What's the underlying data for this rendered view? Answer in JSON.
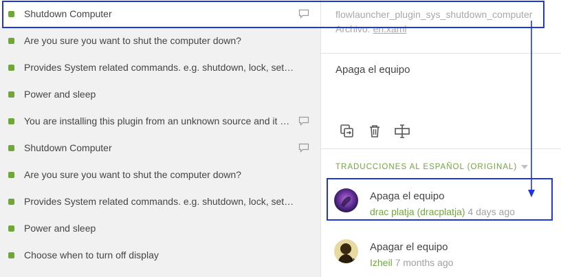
{
  "strings": [
    {
      "text": "Shutdown Computer",
      "has_comment": true,
      "selected": true
    },
    {
      "text": "Are you sure you want to shut the computer down?",
      "has_comment": false
    },
    {
      "text": "Provides System related commands. e.g. shutdown, lock, settings...",
      "has_comment": false
    },
    {
      "text": "Power and sleep",
      "has_comment": false
    },
    {
      "text": "You are installing this plugin from an unknown source and it m...",
      "has_comment": true
    },
    {
      "text": "Shutdown Computer",
      "has_comment": true
    },
    {
      "text": "Are you sure you want to shut the computer down?",
      "has_comment": false
    },
    {
      "text": "Provides System related commands. e.g. shutdown, lock, settings...",
      "has_comment": false
    },
    {
      "text": "Power and sleep",
      "has_comment": false
    },
    {
      "text": "Choose when to turn off display",
      "has_comment": false
    }
  ],
  "detail": {
    "key": "flowlauncher_plugin_sys_shutdown_computer",
    "file_label": "Archivo:",
    "file_name": "en.xaml",
    "translation": "Apaga el equipo",
    "tools": [
      {
        "name": "copy-source-icon"
      },
      {
        "name": "trash-icon"
      },
      {
        "name": "text-cursor-icon"
      }
    ],
    "section_header": "TRADUCCIONES AL ESPAÑOL (ORIGINAL)",
    "suggestions": [
      {
        "text": "Apaga el equipo",
        "user": "drac platja (dracplatja)",
        "time": "4 days ago"
      },
      {
        "text": "Apagar el equipo",
        "user": "Izheil",
        "time": "7 months ago"
      }
    ]
  },
  "colors": {
    "status_green": "#6fa839",
    "annotation_blue": "#1f36d6",
    "panel_bg": "#f1f1f1"
  }
}
